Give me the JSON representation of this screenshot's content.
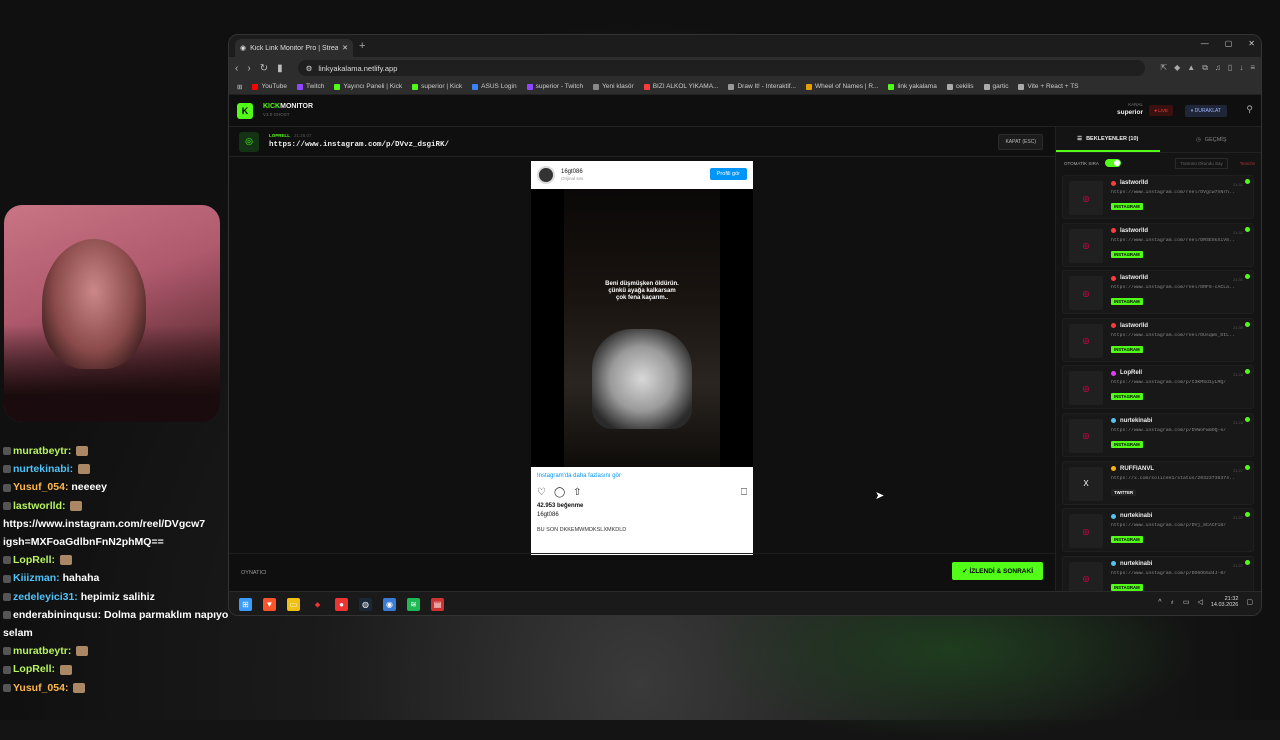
{
  "browser": {
    "tab_title": "Kick Link Monitor Pro | Stream",
    "url": "linkyakalama.netlify.app",
    "window_controls": [
      "—",
      "▢",
      "✕"
    ],
    "bookmarks": [
      {
        "label": "YouTube",
        "color": "#ff0000"
      },
      {
        "label": "Twitch",
        "color": "#9146ff"
      },
      {
        "label": "Yayıncı Paneli | Kick",
        "color": "#53fc18"
      },
      {
        "label": "superior | Kick",
        "color": "#53fc18"
      },
      {
        "label": "ASUS Login",
        "color": "#3b82f6"
      },
      {
        "label": "superior - Twitch",
        "color": "#9146ff"
      },
      {
        "label": "Yeni klasör",
        "color": "#888888"
      },
      {
        "label": "BIZI ALKOL YIKAMA...",
        "color": "#ff3b3b"
      },
      {
        "label": "Draw It! - Interaktif...",
        "color": "#999999"
      },
      {
        "label": "Wheel of Names | R...",
        "color": "#e5a000"
      },
      {
        "label": "link yakalama",
        "color": "#53fc18"
      },
      {
        "label": "cekilis",
        "color": "#aaaaaa"
      },
      {
        "label": "gartic",
        "color": "#aaaaaa"
      },
      {
        "label": "Vite + React + TS",
        "color": "#aaaaaa"
      }
    ]
  },
  "app": {
    "logo_letter": "K",
    "brand_prefix": "KICK",
    "brand_suffix": "MONITOR",
    "version": "V3.0 GHOST",
    "channel_label": "KANAL",
    "channel_name": "superior",
    "live_label": "● LIVE",
    "pause_label": "⏸ DURAKLAT",
    "accent": "#53fc18"
  },
  "current_link": {
    "user": "LOPRELL",
    "time": "21:25:07",
    "url": "https://www.instagram.com/p/DVvz_dsgiRK/",
    "close_label": "KAPAT (ESC)"
  },
  "embed": {
    "username": "16gt086",
    "subtitle": "Orijinal ses",
    "profile_button": "Profili gör",
    "video_caption": "Beni düşmüşken öldürün.\nçünkü ayağa kalkarsam\nçok fena kaçarım..",
    "more_link": "Instagram'da daha fazlasını gör",
    "likes": "42.953 beğenme",
    "author": "16gt086",
    "caption": "BU SON DKKEMWMDKSLXMKDLD"
  },
  "player": {
    "label": "OYNATICI",
    "next_button": "✓ İZLENDİ & SONRAKİ"
  },
  "sidebar": {
    "tab_waiting": "BEKLEYENLER (10)",
    "tab_history": "GEÇMİŞ",
    "auto_label": "OTOMATİK SIRA",
    "read_all": "Tümünü Okundu Say",
    "clear": "Temizle",
    "items": [
      {
        "user": "lastworlld",
        "dot": "#ff3b3b",
        "url": "https://www.instagram.com/reel/DVgcw7nNrh...",
        "badge": "INSTAGRAM",
        "time": "21:31"
      },
      {
        "user": "lastworlld",
        "dot": "#ff3b3b",
        "url": "https://www.instagram.com/reel/DRSE5kXiV8...",
        "badge": "INSTAGRAM",
        "time": "21:31"
      },
      {
        "user": "lastworlld",
        "dot": "#ff3b3b",
        "url": "https://www.instagram.com/reel/DRF5-cACLa...",
        "badge": "INSTAGRAM",
        "time": "21:31"
      },
      {
        "user": "lastworlld",
        "dot": "#ff3b3b",
        "url": "https://www.instagram.com/reel/DUsqWx_DIL...",
        "badge": "INSTAGRAM",
        "time": "21:30"
      },
      {
        "user": "LopRell",
        "dot": "#e040fb",
        "url": "https://www.instagram.com/p/C3KMSd1yLMQ/",
        "badge": "INSTAGRAM",
        "time": "21:28"
      },
      {
        "user": "nurtekinabi",
        "dot": "#4fc3f7",
        "url": "https://www.instagram.com/p/DVWoFwmOQ-e/",
        "badge": "INSTAGRAM",
        "time": "21:28"
      },
      {
        "user": "RUFFIANVL",
        "dot": "#ffb300",
        "url": "https://x.com/solicee1/status/20323736374...",
        "badge": "TWITTER",
        "time": "21:27"
      },
      {
        "user": "nurtekinabi",
        "dot": "#4fc3f7",
        "url": "https://www.instagram.com/p/DVj_8CACF18/",
        "badge": "INSTAGRAM",
        "time": "21:27"
      },
      {
        "user": "nurtekinabi",
        "dot": "#4fc3f7",
        "url": "https://www.instagram.com/p/DO6Ob5d4J-0/",
        "badge": "INSTAGRAM",
        "time": "21:27"
      }
    ]
  },
  "taskbar": {
    "time": "21:32",
    "date": "14.03.2026"
  },
  "chat": [
    {
      "user": "muratbeytr:",
      "color": "#b7f35f",
      "text": ""
    },
    {
      "user": "nurtekinabi:",
      "color": "#4fc3f7",
      "text": ""
    },
    {
      "user": "Yusuf_054:",
      "color": "#ffb74d",
      "text": "neeeey"
    },
    {
      "user": "lastworlld:",
      "color": "#b7f35f",
      "text": ""
    },
    {
      "user": "",
      "color": "#ffffff",
      "text": "https://www.instagram.com/reel/DVgcw7"
    },
    {
      "user": "",
      "color": "#ffffff",
      "text": "igsh=MXFoaGdlbnFnN2phMQ=="
    },
    {
      "user": "LopRell:",
      "color": "#b7f35f",
      "text": ""
    },
    {
      "user": "Kiiizman:",
      "color": "#4fc3f7",
      "text": "hahaha"
    },
    {
      "user": "zedeleyici31:",
      "color": "#4fc3f7",
      "text": "hepimiz salihiz"
    },
    {
      "user": "enderabininqusu:",
      "color": "#ffffff",
      "text": "Dolma parmaklım napıyo"
    },
    {
      "user": "",
      "color": "#ffffff",
      "text": "selam"
    },
    {
      "user": "muratbeytr:",
      "color": "#b7f35f",
      "text": ""
    },
    {
      "user": "LopRell:",
      "color": "#b7f35f",
      "text": ""
    },
    {
      "user": "Yusuf_054:",
      "color": "#ffb74d",
      "text": ""
    }
  ]
}
